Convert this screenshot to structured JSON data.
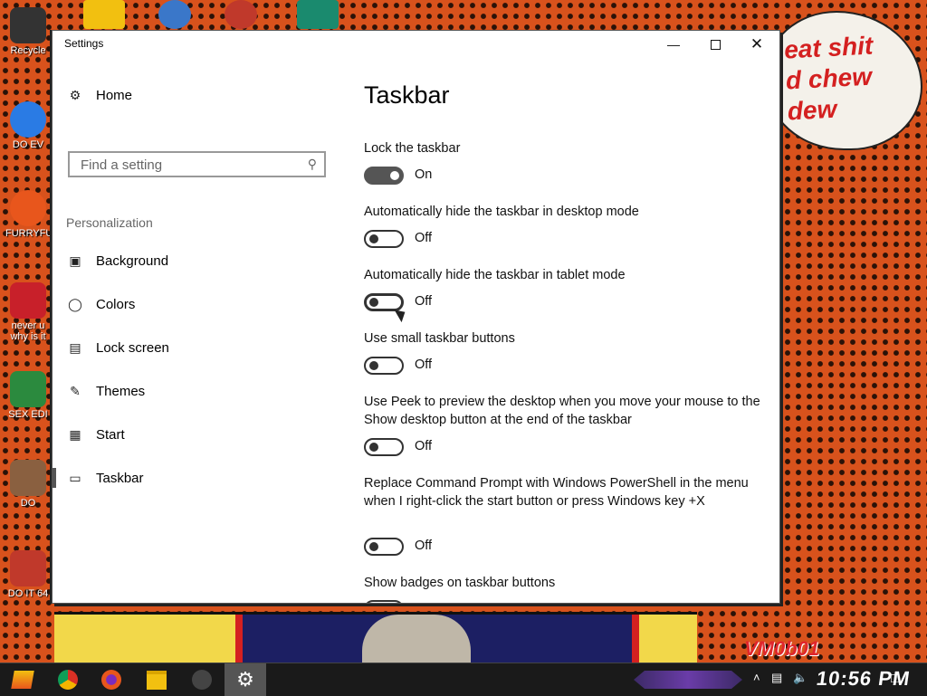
{
  "window": {
    "title": "Settings",
    "minimize_icon": "minimize-icon",
    "maximize_icon": "maximize-icon",
    "close_icon": "close-icon"
  },
  "sidebar": {
    "home_label": "Home",
    "search_placeholder": "Find a setting",
    "section_label": "Personalization",
    "items": [
      {
        "label": "Background",
        "icon": "picture-icon"
      },
      {
        "label": "Colors",
        "icon": "palette-icon"
      },
      {
        "label": "Lock screen",
        "icon": "lock-screen-icon"
      },
      {
        "label": "Themes",
        "icon": "themes-icon"
      },
      {
        "label": "Start",
        "icon": "start-icon"
      },
      {
        "label": "Taskbar",
        "icon": "taskbar-icon",
        "selected": true
      }
    ]
  },
  "main": {
    "heading": "Taskbar",
    "settings": [
      {
        "label": "Lock the taskbar",
        "state": "On"
      },
      {
        "label": "Automatically hide the taskbar in desktop mode",
        "state": "Off"
      },
      {
        "label": "Automatically hide the taskbar in tablet mode",
        "state": "Off"
      },
      {
        "label": "Use small taskbar buttons",
        "state": "Off"
      },
      {
        "label": "Use Peek to preview the desktop when you move your mouse to the Show desktop button at the end of the taskbar",
        "state": "Off"
      },
      {
        "label": "Replace Command Prompt with Windows PowerShell in the menu when I right-click the start button or press Windows key +X",
        "state": "Off"
      },
      {
        "label": "Show badges on taskbar buttons",
        "state": ""
      }
    ]
  },
  "desktop": {
    "icons": [
      {
        "label": "Recycle",
        "color": "#333333"
      },
      {
        "label": "DO EV",
        "color": "#2a7be4"
      },
      {
        "label": "FURRYFU",
        "color": "#e8561c"
      },
      {
        "label": "never u why is it",
        "color": "#c8202a"
      },
      {
        "label": "SEX EDI",
        "color": "#2b8a3e"
      },
      {
        "label": "DO",
        "color": "#8a6040"
      },
      {
        "label": "DO IT 64",
        "color": "#c0392b"
      }
    ],
    "speech_text": [
      "eat shit",
      "d chew",
      "d",
      "dew"
    ],
    "watermark": "VM0b01"
  },
  "taskbar": {
    "clock": "10:56 PM",
    "apps": [
      "start-icon",
      "chrome-icon",
      "firefox-icon",
      "file-explorer-icon",
      "app-icon",
      "settings-icon"
    ]
  },
  "colors": {
    "accent": "#555555",
    "desktop_bg": "#d8521c",
    "speech_text": "#d42020"
  }
}
